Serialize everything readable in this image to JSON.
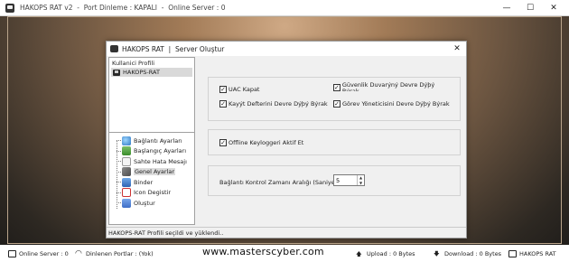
{
  "app": {
    "title": "HAKOPS RAT v2  -  Port Dinleme : KAPALI  -  Online Server : 0",
    "controls": {
      "minimize": "—",
      "maximize": "☐",
      "close": "✕"
    }
  },
  "dialog": {
    "title": "HAKOPS RAT  |  Server Oluştur",
    "close": "✕",
    "profile": {
      "header": "Kullanici Profili",
      "items": [
        "HAKOPS-RAT"
      ]
    },
    "menu": [
      {
        "label": "Bağlantı Ayarları",
        "icon": "globe-icon"
      },
      {
        "label": "Başlangıç Ayarları",
        "icon": "startup-icon"
      },
      {
        "label": "Sahte Hata Mesajı",
        "icon": "error-message-icon"
      },
      {
        "label": "Genel Ayarlar",
        "icon": "settings-icon",
        "selected": true
      },
      {
        "label": "Binder",
        "icon": "binder-icon"
      },
      {
        "label": "Icon Degistir",
        "icon": "icon-change-icon"
      },
      {
        "label": "Oluştur",
        "icon": "build-icon"
      }
    ],
    "options": {
      "uac": {
        "label": "UAC Kapat",
        "checked": true
      },
      "firewall": {
        "label": "Güvenlik Duvarýný Devre Dýþý Býrak",
        "checked": true
      },
      "registry": {
        "label": "Kayýt Defterini Devre Dýþý Býrak",
        "checked": true
      },
      "taskmgr": {
        "label": "Görev Yöneticisini Devre Dýþý Býrak",
        "checked": true
      },
      "keylogger": {
        "label": "Offline Keyloggeri Aktif Et",
        "checked": true
      },
      "interval_label": "Bağlantı Kontrol Zamanı Aralığı (Saniye) :",
      "interval_value": "5"
    },
    "status": "HAKOPS-RAT Profili seçildi ve yüklendi.."
  },
  "statusbar": {
    "online": "Online Server : 0",
    "ports": "Dinlenen Portlar : (Yok)",
    "watermark": "www.masterscyber.com",
    "upload": "Upload : 0 Bytes",
    "download": "Download : 0 Bytes",
    "brand": "HAKOPS RAT"
  }
}
